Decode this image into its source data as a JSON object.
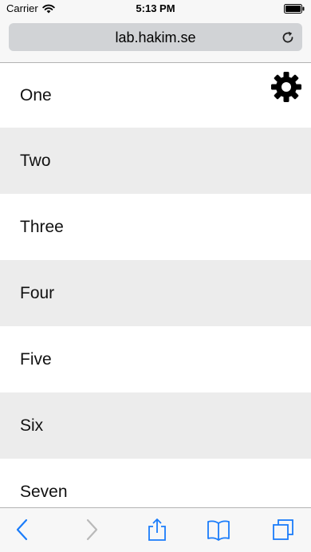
{
  "status_bar": {
    "carrier": "Carrier",
    "time": "5:13 PM",
    "icons": [
      "wifi-icon",
      "battery-icon"
    ]
  },
  "address_bar": {
    "url": "lab.hakim.se",
    "icons": [
      "reload-icon"
    ]
  },
  "page": {
    "settings_icon": "gear-icon",
    "items": [
      {
        "label": "One"
      },
      {
        "label": "Two"
      },
      {
        "label": "Three"
      },
      {
        "label": "Four"
      },
      {
        "label": "Five"
      },
      {
        "label": "Six"
      },
      {
        "label": "Seven"
      }
    ]
  },
  "toolbar": {
    "buttons": [
      "back-icon",
      "forward-icon",
      "share-icon",
      "bookmarks-icon",
      "tabs-icon"
    ],
    "accent_color": "#1a7cfa"
  },
  "colors": {
    "alt_row": "#ececec",
    "address_field": "#d1d3d6"
  }
}
